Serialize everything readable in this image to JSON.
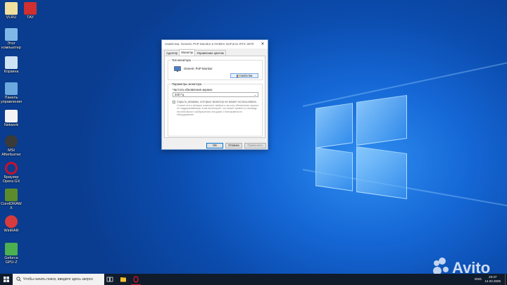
{
  "desktop": {
    "icons": [
      {
        "label": "VLRU",
        "color": "#f0e0a0"
      },
      {
        "label": "ТАУ",
        "color": "#d03030"
      },
      {
        "label": "Этот компьютер",
        "color": "#7fb8e8"
      },
      {
        "label": "Корзина",
        "color": "#cfe3f4"
      },
      {
        "label": "Панель управления",
        "color": "#6aa8de"
      },
      {
        "label": "Network",
        "color": "#f4f4f4"
      },
      {
        "label": "MSI Afterburner",
        "color": "#3a3a3a"
      },
      {
        "label": "Браузер Opera GX",
        "color": "#c8102e"
      },
      {
        "label": "CorelDRAW X",
        "color": "#5d8a2a"
      },
      {
        "label": "WinRAR",
        "color": "#d83b3b"
      },
      {
        "label": "Geforce GPU-Z",
        "color": "#4caf50"
      }
    ]
  },
  "dialog": {
    "title": "Свойства: Generic PnP Monitor и NVIDIA GeForce RTX 3070",
    "close_icon": "close-icon",
    "tabs": [
      {
        "label": "Адаптер",
        "active": false
      },
      {
        "label": "Монитор",
        "active": true
      },
      {
        "label": "Управление цветом",
        "active": false
      }
    ],
    "monitor_type": {
      "group_title": "Тип монитора",
      "monitor_name": "Generic PnP Monitor",
      "properties_button": "Свойства"
    },
    "monitor_settings": {
      "group_title": "Параметры монитора",
      "refresh_label": "Частота обновления экрана:",
      "refresh_value": "240 Гц",
      "hide_modes_label": "Скрыть режимы, которые монитор не может использовать",
      "hide_modes_checked": false,
      "hide_modes_description": "Снятие этого флажка позволяет выбрать частоту обновления экрана, не поддерживаемую этим монитором, что может привести к выводу нестабильного изображения или даже к неисправности оборудования."
    },
    "buttons": {
      "ok": "ОК",
      "cancel": "Отмена",
      "apply": "Применить"
    }
  },
  "taskbar": {
    "search_placeholder": "Чтобы начать поиск, введите здесь запрос",
    "language": "ENG",
    "time": "23:47",
    "date": "14.02.2025"
  },
  "watermark": {
    "text": "Avito"
  },
  "colors": {
    "accent": "#0078d7",
    "taskbar": "#101c2c"
  }
}
